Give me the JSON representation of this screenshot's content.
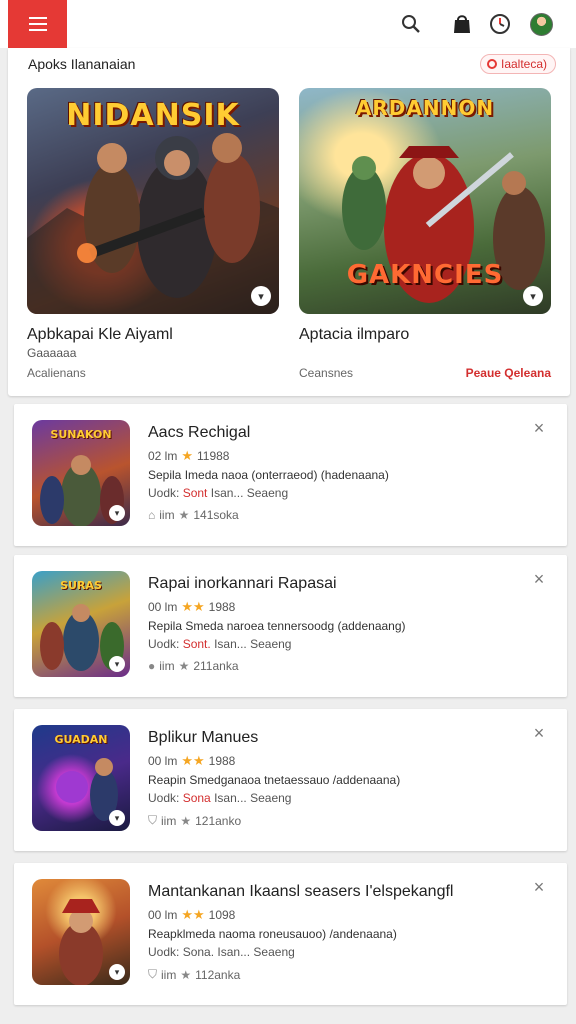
{
  "colors": {
    "accent": "#e53935",
    "star": "#f5a623"
  },
  "header": {
    "menu_icon": "hamburger-icon",
    "icons": [
      "search-icon",
      "bag-icon",
      "clock-icon",
      "avatar"
    ]
  },
  "featured": {
    "title": "Apoks Ilananaian",
    "badge": "Iaalteca)",
    "cards": [
      {
        "art_text": "NIDANSIK",
        "name": "Apbkapai Kle Aiyaml",
        "sub": "Gaaaaaa",
        "meta": "Acalienans",
        "action": ""
      },
      {
        "art_text_top": "ARDANNON",
        "art_text_bottom": "GAKNCIES",
        "name": "Aptacia ilmparo",
        "sub": "",
        "meta": "Ceansnes",
        "action": "Peaue Qeleana"
      }
    ]
  },
  "list": [
    {
      "art_text": "SUNAKON",
      "title": "Aacs Rechigal",
      "size": "02 lm",
      "stars": "★",
      "rating": "11988",
      "desc": "Sepila Imeda naoa (onterraeod) (hadenaana)",
      "note_a": "Uodk:",
      "note_red": "Sont",
      "note_b": "Isan... Seaeng",
      "stat_a": "iim",
      "stat_b": "141soka"
    },
    {
      "art_text": "SURAS",
      "title": "Rapai inorkannari Rapasai",
      "size": "00 lm",
      "stars": "★★",
      "rating": "1988",
      "desc": "Repila Smeda naroea tennersoodg (addenaang)",
      "note_a": "Uodk:",
      "note_red": "Sont.",
      "note_b": "Isan... Seaeng",
      "stat_a": "iim",
      "stat_b": "211anka"
    },
    {
      "art_text": "GUADAN",
      "title": "Bplikur Manues",
      "size": "00 lm",
      "stars": "★★",
      "rating": "1988",
      "desc": "Reapin Smedganaoa tnetaessauo /addenaana)",
      "note_a": "Uodk:",
      "note_red": "Sona",
      "note_b": "Isan... Seaeng",
      "stat_a": "iim",
      "stat_b": "121anko"
    },
    {
      "art_text": "",
      "title": "Mantankanan Ikaansl seasers I'elspekangfl",
      "size": "00 lm",
      "stars": "★★",
      "rating": "1098",
      "desc": "Reapklmeda naoma roneusauoo) /andenaana)",
      "note_a": "Uodk:",
      "note_red": "Sona.",
      "note_b": "Isan... Seaeng",
      "stat_a": "iim",
      "stat_b": "112anka"
    }
  ]
}
